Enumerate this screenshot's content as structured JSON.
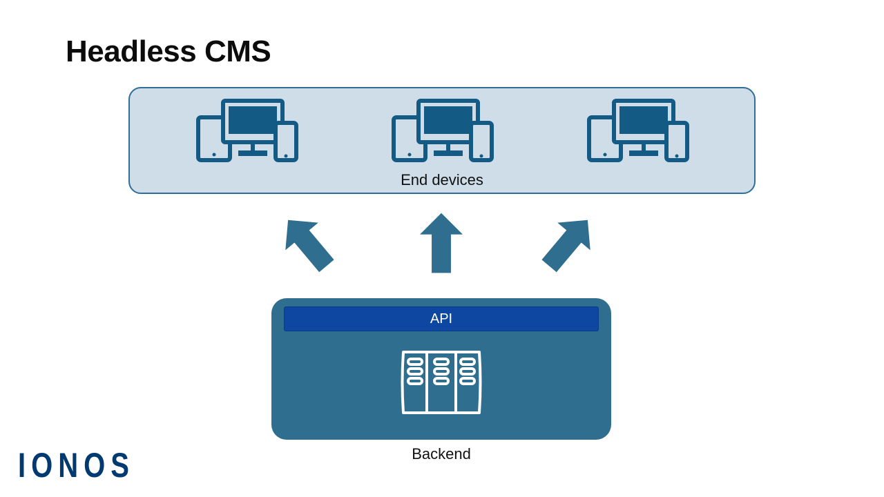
{
  "title": "Headless CMS",
  "end_devices_label": "End devices",
  "api_label": "API",
  "backend_label": "Backend",
  "logo_text": "IONOS",
  "colors": {
    "box_bg": "#cedde7",
    "box_border": "#2f6e97",
    "backend_bg": "#2f6e8e",
    "api_bg": "#0d47a1",
    "arrow": "#2f6e8e",
    "logo": "#003a70"
  }
}
